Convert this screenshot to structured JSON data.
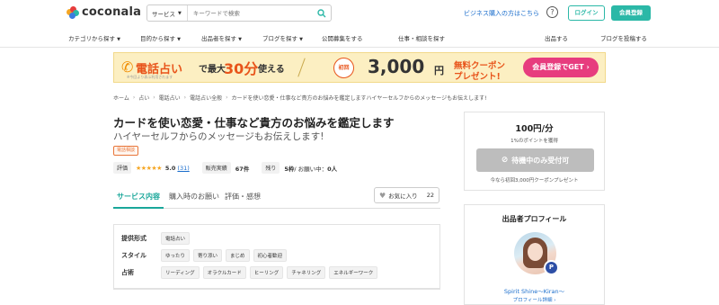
{
  "header": {
    "logo_text": "coconala",
    "search_category": "サービス",
    "search_placeholder": "キーワードで検索",
    "business_link": "ビジネス購入の方はこちら",
    "help_symbol": "?",
    "login_label": "ログイン",
    "signup_label": "会員登録"
  },
  "nav": {
    "items": [
      "カテゴリから探す",
      "目的から探す",
      "出品者を探す",
      "ブログを探す",
      "公開募集をする",
      "仕事・相談を探す"
    ],
    "right_items": [
      "出品する",
      "ブログを投稿する"
    ]
  },
  "banner": {
    "t1": "電話占い",
    "t2": "で最大",
    "t3": "30分",
    "t4": "使える",
    "note": "※今回より表示利用されます",
    "first_label": "初回",
    "amount": "3,000",
    "yen": "円",
    "coupon_line1": "無料クーポン",
    "coupon_line2": "プレゼント!",
    "cta": "会員登録でGET ›"
  },
  "breadcrumb": [
    "ホーム",
    "占い",
    "電話占い",
    "電話占い全般",
    "カードを使い恋愛・仕事など貴方のお悩みを鑑定しますハイヤーセルフからのメッセージもお伝えします!"
  ],
  "service": {
    "title": "カードを使い恋愛・仕事など貴方のお悩みを鑑定します",
    "subtitle": "ハイヤーセルフからのメッセージもお伝えします!",
    "tag": "電話相談",
    "rating_label": "評価",
    "stars": "★★★★★",
    "rating": "5.0",
    "reviews": "(31)",
    "sales_label": "販売実績",
    "sales": "67件",
    "remaining_label": "残り",
    "remaining": "5枠",
    "waiting_label": "/ お願い中：",
    "waiting": "0人"
  },
  "tabs": [
    "サービス内容",
    "購入時のお願い",
    "評価・感想"
  ],
  "favorite": {
    "label": "お気に入り",
    "count": "22"
  },
  "specs": {
    "rows": [
      {
        "label": "提供形式",
        "chips": [
          "電話占い"
        ]
      },
      {
        "label": "スタイル",
        "chips": [
          "ゆったり",
          "寄り添い",
          "まじめ",
          "初心者歓迎"
        ]
      },
      {
        "label": "占術",
        "chips": [
          "リーディング",
          "オラクルカード",
          "ヒーリング",
          "チャネリング",
          "エネルギーワーク"
        ]
      }
    ]
  },
  "pricing": {
    "price": "100円/分",
    "points": "1%のポイントを獲得",
    "button": "待機中のみ受付可",
    "coupon_note": "今なら初回3,000円クーポンプレゼント"
  },
  "profile": {
    "title": "出品者プロフィール",
    "badge": "P",
    "name": "Spirit Shine〜Kiran〜",
    "link": "プロフィール詳細 ›"
  },
  "colors": {
    "accent": "#2bb8a7",
    "tab_active": "#1aa79a",
    "link": "#1a6dcc",
    "banner_bg": "#fcefc2",
    "banner_cta": "#e73c7e"
  }
}
